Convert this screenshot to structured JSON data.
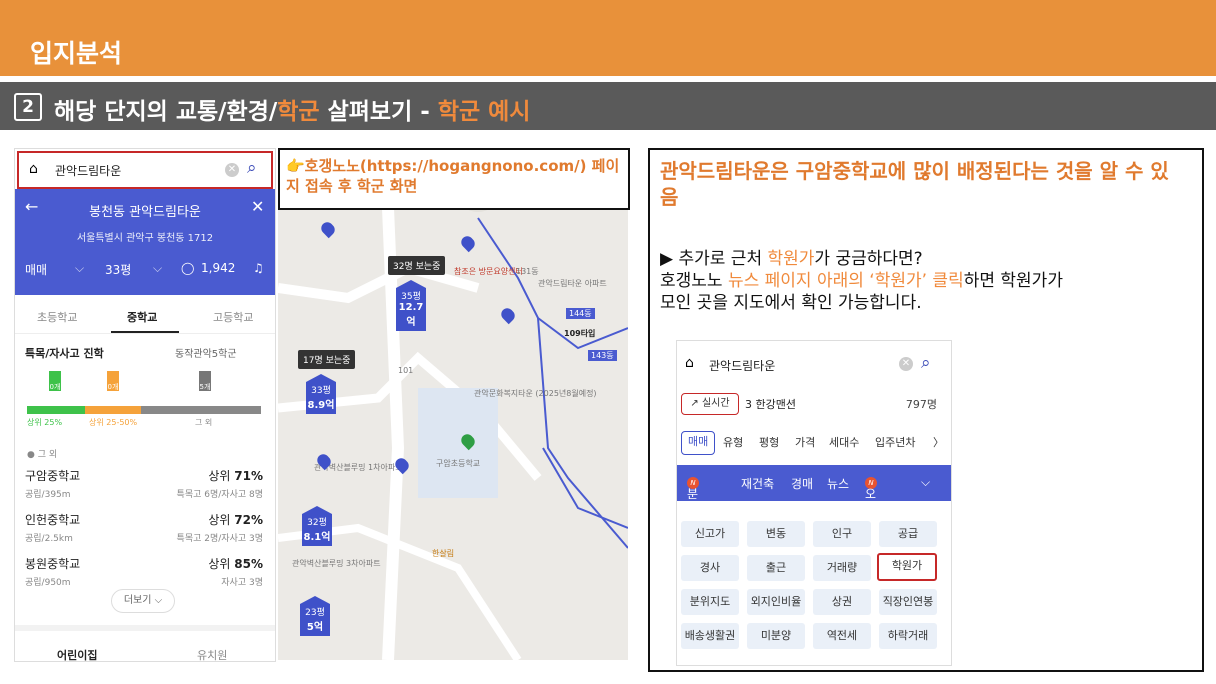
{
  "header": {
    "title": "입지분석"
  },
  "subheader": {
    "num": "2",
    "title_pre": "해당 단지의 교통/환경/",
    "title_hl": "학군",
    "title_mid": " 살펴보기 - ",
    "title_hl2": "학군 예시"
  },
  "phone": {
    "search_text": "관악드림타운",
    "apt_name": "봉천동 관악드림타운",
    "address": "서울특별시 관악구 봉천동 1712",
    "deal": "매매",
    "size": "33평",
    "comments": "1,942",
    "tabs": [
      "초등학교",
      "중학교",
      "고등학교"
    ],
    "section_title": "특목/자사고 진학",
    "district": "동작관악5학군",
    "flags": [
      "0개",
      "0개",
      "5개"
    ],
    "bar_labels": [
      "상위 25%",
      "상위 25-50%",
      "그 외"
    ],
    "legend": "● 그 외",
    "schools": [
      {
        "name": "구암중학교",
        "sub": "공립/395m",
        "rank_pre": "상위 ",
        "rank": "71%",
        "detail": "특목고 6명/자사고 8명"
      },
      {
        "name": "인헌중학교",
        "sub": "공립/2.5km",
        "rank_pre": "상위 ",
        "rank": "72%",
        "detail": "특목고 2명/자사고 3명"
      },
      {
        "name": "봉원중학교",
        "sub": "공립/950m",
        "rank_pre": "상위 ",
        "rank": "85%",
        "detail": "자사고 3명"
      }
    ],
    "more": "더보기 ⌵",
    "bottom_tabs": [
      "어린이집",
      "유치원"
    ]
  },
  "map": {
    "note": "👉호갱노노(https://hogangnono.com/) 페이지 접속 후 학군 화면",
    "labels": {
      "l32": "32명 보는중",
      "l17": "17명 보는중"
    },
    "prices": [
      {
        "py": "35평",
        "price": "12.7억"
      },
      {
        "py": "33평",
        "price": "8.9억"
      },
      {
        "py": "32평",
        "price": "8.1억"
      },
      {
        "py": "23평",
        "price": "5억"
      }
    ],
    "place_names": [
      "참조은 방문요양센터",
      "관악드림타운 아파트",
      "관악문화복지타운 (2025년8월예정)",
      "관악벽산블루밍 1차아파트",
      "구암초등학교",
      "관악벽산블루밍 3차아파트",
      "한살림",
      "131동",
      "109타입",
      "144동",
      "143동",
      "101"
    ]
  },
  "right": {
    "title": "관악드림타운은 구암중학교에 많이 배정된다는 것을 알 수 있음",
    "line1_pre": "▶ 추가로 근처 ",
    "line1_hl": "학원가",
    "line1_post": "가 궁금하다면?",
    "line2_pre": "호갱노노 ",
    "line2_hl": "뉴스 페이지 아래의 ‘학원가’ 클릭",
    "line2_post": "하면 학원가가",
    "line3": "모인 곳을 지도에서 확인 가능합니다."
  },
  "shot": {
    "search": "관악드림타운",
    "live": "↗ 실시간",
    "live_item": "3 한강맨션",
    "live_count": "797명",
    "filters": [
      "매매",
      "유형",
      "평형",
      "가격",
      "세대수",
      "입주년차",
      "〉"
    ],
    "nav": [
      "분양",
      "재건축",
      "경매",
      "뉴스",
      "오늘",
      "⌵"
    ],
    "grid": [
      [
        "신고가",
        "변동",
        "인구",
        "공급"
      ],
      [
        "경사",
        "출근",
        "거래량",
        "학원가"
      ],
      [
        "분위지도",
        "외지인비율",
        "상권",
        "직장인연봉"
      ],
      [
        "배송생활권",
        "미분양",
        "역전세",
        "하락거래"
      ]
    ]
  },
  "colors": {
    "accent": "#E8913A",
    "blue": "#4a5bd0",
    "highlight": "#c62828"
  }
}
